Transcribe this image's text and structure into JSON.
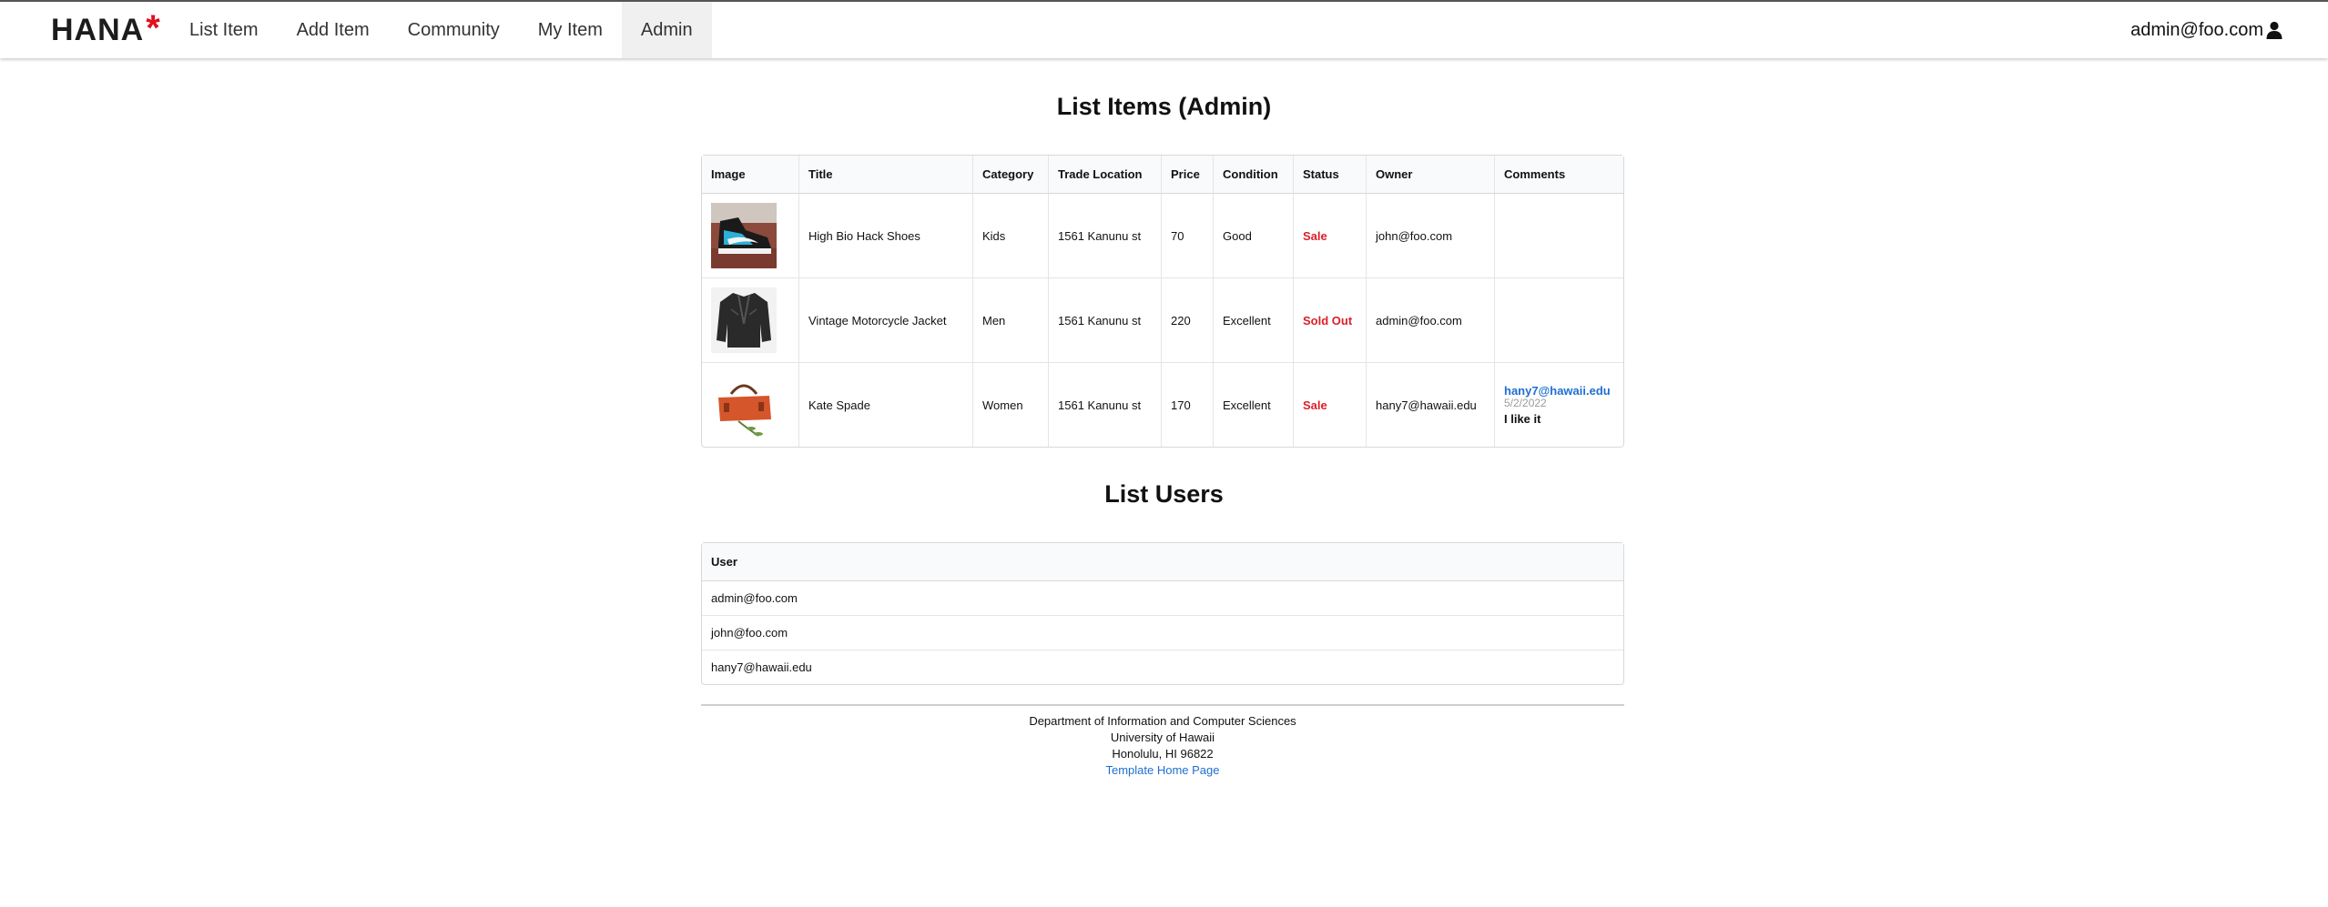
{
  "nav": {
    "brand": "HANA",
    "brand_mark": "*",
    "items": [
      {
        "label": "List Item"
      },
      {
        "label": "Add Item"
      },
      {
        "label": "Community"
      },
      {
        "label": "My Item"
      },
      {
        "label": "Admin",
        "active": true
      }
    ],
    "user": "admin@foo.com",
    "user_icon": "user-icon"
  },
  "items_section": {
    "title": "List Items (Admin)",
    "headers": [
      "Image",
      "Title",
      "Category",
      "Trade Location",
      "Price",
      "Condition",
      "Status",
      "Owner",
      "Comments"
    ],
    "rows": [
      {
        "image": "sneaker-image",
        "title": "High Bio Hack Shoes",
        "category": "Kids",
        "location": "1561 Kanunu st",
        "price": "70",
        "condition": "Good",
        "status": "Sale",
        "owner": "john@foo.com",
        "comment": null
      },
      {
        "image": "jacket-image",
        "title": "Vintage Motorcycle Jacket",
        "category": "Men",
        "location": "1561 Kanunu st",
        "price": "220",
        "condition": "Excellent",
        "status": "Sold Out",
        "owner": "admin@foo.com",
        "comment": null
      },
      {
        "image": "handbag-image",
        "title": "Kate Spade",
        "category": "Women",
        "location": "1561 Kanunu st",
        "price": "170",
        "condition": "Excellent",
        "status": "Sale",
        "owner": "hany7@hawaii.edu",
        "comment": {
          "author": "hany7@hawaii.edu",
          "date": "5/2/2022",
          "text": "I like it"
        }
      }
    ]
  },
  "users_section": {
    "title": "List Users",
    "header": "User",
    "rows": [
      "admin@foo.com",
      "john@foo.com",
      "hany7@hawaii.edu"
    ]
  },
  "footer": {
    "line1": "Department of Information and Computer Sciences",
    "line2": "University of Hawaii",
    "line3": "Honolulu, HI 96822",
    "link": "Template Home Page"
  },
  "colors": {
    "status": "#db1f28",
    "link": "#1f6fd0",
    "brand_mark": "#e0101e",
    "active_nav": "#f0f0f0"
  }
}
